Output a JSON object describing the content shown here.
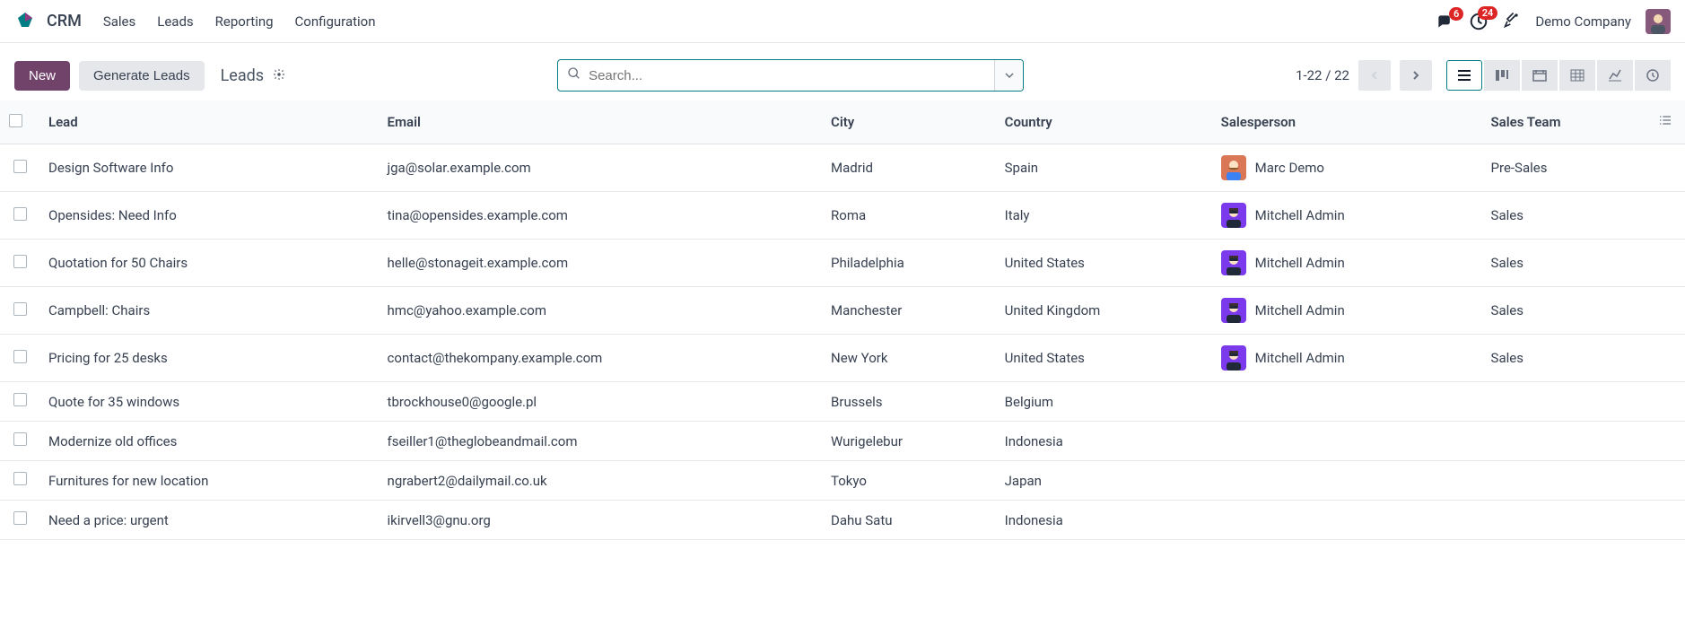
{
  "app": {
    "title": "CRM"
  },
  "nav": {
    "items": [
      "Sales",
      "Leads",
      "Reporting",
      "Configuration"
    ]
  },
  "header_right": {
    "messages_badge": "6",
    "activities_badge": "24",
    "company": "Demo Company"
  },
  "controls": {
    "new_label": "New",
    "generate_label": "Generate Leads",
    "breadcrumb": "Leads",
    "search_placeholder": "Search...",
    "pager": "1-22 / 22"
  },
  "table": {
    "columns": [
      "Lead",
      "Email",
      "City",
      "Country",
      "Salesperson",
      "Sales Team"
    ],
    "rows": [
      {
        "lead": "Design Software Info",
        "email": "jga@solar.example.com",
        "city": "Madrid",
        "country": "Spain",
        "salesperson": "Marc Demo",
        "salesperson_avatar": "marc",
        "team": "Pre-Sales"
      },
      {
        "lead": "Opensides: Need Info",
        "email": "tina@opensides.example.com",
        "city": "Roma",
        "country": "Italy",
        "salesperson": "Mitchell Admin",
        "salesperson_avatar": "mitchell",
        "team": "Sales"
      },
      {
        "lead": "Quotation for 50 Chairs",
        "email": "helle@stonageit.example.com",
        "city": "Philadelphia",
        "country": "United States",
        "salesperson": "Mitchell Admin",
        "salesperson_avatar": "mitchell",
        "team": "Sales"
      },
      {
        "lead": "Campbell: Chairs",
        "email": "hmc@yahoo.example.com",
        "city": "Manchester",
        "country": "United Kingdom",
        "salesperson": "Mitchell Admin",
        "salesperson_avatar": "mitchell",
        "team": "Sales"
      },
      {
        "lead": "Pricing for 25 desks",
        "email": "contact@thekompany.example.com",
        "city": "New York",
        "country": "United States",
        "salesperson": "Mitchell Admin",
        "salesperson_avatar": "mitchell",
        "team": "Sales"
      },
      {
        "lead": "Quote for 35 windows",
        "email": "tbrockhouse0@google.pl",
        "city": "Brussels",
        "country": "Belgium",
        "salesperson": "",
        "salesperson_avatar": "",
        "team": ""
      },
      {
        "lead": "Modernize old offices",
        "email": "fseiller1@theglobeandmail.com",
        "city": "Wurigelebur",
        "country": "Indonesia",
        "salesperson": "",
        "salesperson_avatar": "",
        "team": ""
      },
      {
        "lead": "Furnitures for new location",
        "email": "ngrabert2@dailymail.co.uk",
        "city": "Tokyo",
        "country": "Japan",
        "salesperson": "",
        "salesperson_avatar": "",
        "team": ""
      },
      {
        "lead": "Need a price: urgent",
        "email": "ikirvell3@gnu.org",
        "city": "Dahu Satu",
        "country": "Indonesia",
        "salesperson": "",
        "salesperson_avatar": "",
        "team": ""
      }
    ]
  }
}
